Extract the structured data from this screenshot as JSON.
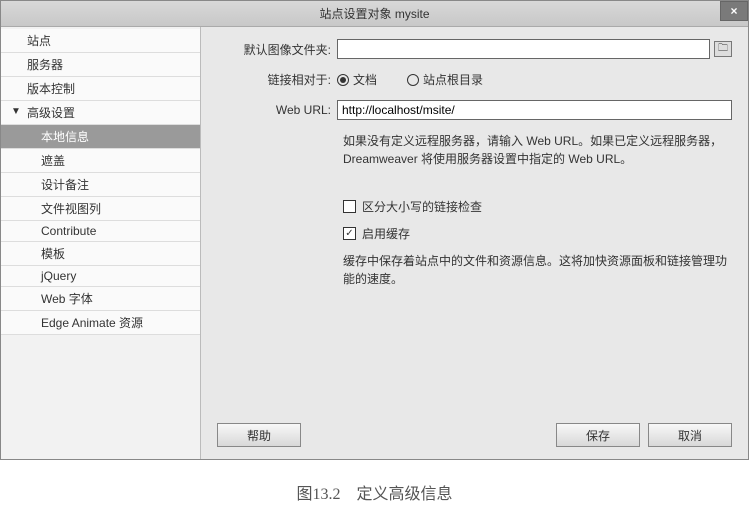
{
  "title": "站点设置对象 mysite",
  "close": "×",
  "sidebar": {
    "items": [
      {
        "label": "站点"
      },
      {
        "label": "服务器"
      },
      {
        "label": "版本控制"
      },
      {
        "label": "高级设置"
      },
      {
        "label": "本地信息"
      },
      {
        "label": "遮盖"
      },
      {
        "label": "设计备注"
      },
      {
        "label": "文件视图列"
      },
      {
        "label": "Contribute"
      },
      {
        "label": "模板"
      },
      {
        "label": "jQuery"
      },
      {
        "label": "Web 字体"
      },
      {
        "label": "Edge Animate 资源"
      }
    ]
  },
  "form": {
    "folder_label": "默认图像文件夹:",
    "folder_value": "",
    "link_label": "链接相对于:",
    "radio_doc": "文档",
    "radio_root": "站点根目录",
    "weburl_label": "Web URL:",
    "weburl_value": "http://localhost/msite/",
    "info_text": "如果没有定义远程服务器，请输入 Web URL。如果已定义远程服务器，Dreamweaver 将使用服务器设置中指定的 Web URL。",
    "check_case": "区分大小写的链接检查",
    "check_case_checked": false,
    "check_cache": "启用缓存",
    "check_cache_checked": true,
    "cache_info": "缓存中保存着站点中的文件和资源信息。这将加快资源面板和链接管理功能的速度。"
  },
  "buttons": {
    "help": "帮助",
    "save": "保存",
    "cancel": "取消"
  },
  "caption": "图13.2　定义高级信息"
}
